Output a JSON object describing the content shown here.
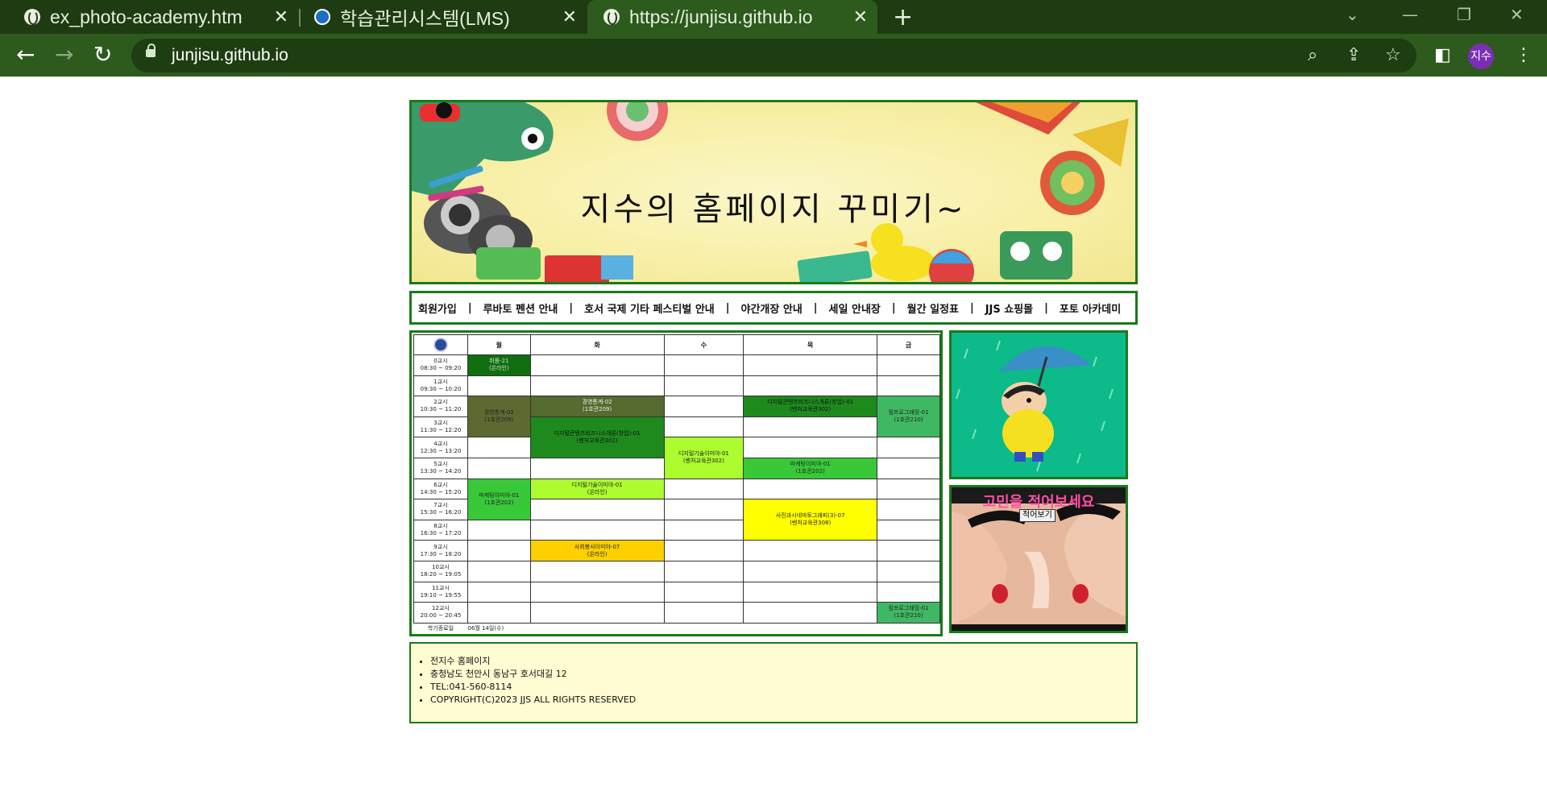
{
  "browser": {
    "tabs": [
      {
        "title": "ex_photo-academy.htm",
        "icon": "globe-icon"
      },
      {
        "title": "학습관리시스템(LMS)",
        "icon": "lms-icon"
      },
      {
        "title": "https://junjisu.github.io",
        "icon": "globe-icon"
      }
    ],
    "url": "junjisu.github.io",
    "profile_initials": "지수"
  },
  "header": {
    "title": "지수의 홈페이지 꾸미기~"
  },
  "nav": {
    "items": [
      "회원가입",
      "루바토 펜션 안내",
      "호서 국제 기타 페스티벌 안내",
      "야간개장 안내",
      "세일 안내장",
      "월간 일정표",
      "JJS 쇼핑몰",
      "포토 아카데미"
    ],
    "separator": "|"
  },
  "timetable": {
    "days": [
      "월",
      "화",
      "수",
      "목",
      "금"
    ],
    "periods": [
      {
        "name": "0교시",
        "time": "08:30 ~ 09:20"
      },
      {
        "name": "1교시",
        "time": "09:30 ~ 10:20"
      },
      {
        "name": "2교시",
        "time": "10:30 ~ 11:20"
      },
      {
        "name": "3교시",
        "time": "11:30 ~ 12:20"
      },
      {
        "name": "4교시",
        "time": "12:30 ~ 13:20"
      },
      {
        "name": "5교시",
        "time": "13:30 ~ 14:20"
      },
      {
        "name": "6교시",
        "time": "14:30 ~ 15:20"
      },
      {
        "name": "7교시",
        "time": "15:30 ~ 16:20"
      },
      {
        "name": "8교시",
        "time": "16:30 ~ 17:20"
      },
      {
        "name": "9교시",
        "time": "17:30 ~ 18:20"
      },
      {
        "name": "10교시",
        "time": "18:20 ~ 19:05"
      },
      {
        "name": "11교시",
        "time": "19:10 ~ 19:55"
      },
      {
        "name": "12교시",
        "time": "20:00 ~ 20:45"
      }
    ],
    "courses": {
      "mon_0": {
        "name": "취품-21",
        "room": "(온라인)"
      },
      "mon_2": {
        "name": "경영통계-02",
        "room": "(1호관209)"
      },
      "mon_6": {
        "name": "마케팅이미야-01",
        "room": "(1호관202)"
      },
      "tue_2": {
        "name": "경영통계-02",
        "room": "(1호관209)"
      },
      "tue_3": {
        "name": "디지털콘텐츠비즈니스개론(창업)-01",
        "room": "(벤처교육관302)"
      },
      "tue_6": {
        "name": "디지털기술이미야-01",
        "room": "(온라인)"
      },
      "tue_9": {
        "name": "사회봉사이미야-07",
        "room": "(온라인)"
      },
      "wed_4": {
        "name": "디지털기술이미야-01",
        "room": "(벤처교육관302)"
      },
      "thu_2": {
        "name": "디지털콘텐츠비즈니스개론(창업)-01",
        "room": "(벤처교육관302)"
      },
      "thu_5": {
        "name": "마케팅이미야-01",
        "room": "(1호관202)"
      },
      "thu_7": {
        "name": "사진과시네마토그래피(3)-07",
        "room": "(벤처교육관308)"
      },
      "fri_2": {
        "name": "컴프로그래밍-01",
        "room": "(1호관210)"
      },
      "fri_12": {
        "name": "컴프로그래밍-01",
        "room": "(1호관210)"
      }
    },
    "semester_end_label": "학기종료일",
    "semester_end_date": "06월 14일(수)"
  },
  "side": {
    "worry_title": "고민을 적어보세요",
    "write_button": "적어보기"
  },
  "footer": {
    "lines": [
      "전지수 홈페이지",
      "충청남도 천안시 동남구 호서대길 12",
      "TEL:041-560-8114",
      "COPYRIGHT(C)2023 JJS ALL RIGHTS RESERVED"
    ]
  },
  "colors": {
    "chrome_dark": "#1e3b12",
    "chrome_toolbar": "#2d5a1d",
    "page_border": "#1a7a1a",
    "banner_bg": "#f8f0a8",
    "footer_bg": "#fffbd2",
    "worry_title": "#ff4fa0"
  }
}
